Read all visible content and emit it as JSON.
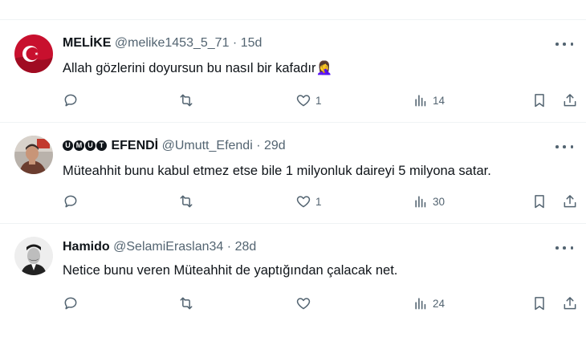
{
  "tweets": [
    {
      "name": "MELİKE",
      "handle": "@melike1453_5_71",
      "dot": "·",
      "time": "15d",
      "text": "Allah gözlerini doyursun bu nasıl bir kafadır",
      "emoji": "🤦‍♀️",
      "replies": "",
      "retweets": "",
      "likes": "1",
      "views": "14",
      "avatar": "turkish-flag"
    },
    {
      "name_badges": [
        "U",
        "M",
        "U",
        "T"
      ],
      "name": "EFENDİ",
      "handle": "@Umutt_Efendi",
      "dot": "·",
      "time": "29d",
      "text": "Müteahhit bunu kabul etmez etse bile 1 milyonluk daireyi 5 milyona satar.",
      "replies": "",
      "retweets": "",
      "likes": "1",
      "views": "30",
      "avatar": "man-photo"
    },
    {
      "name": "Hamido",
      "handle": "@SelamiEraslan34",
      "dot": "·",
      "time": "28d",
      "text": "Netice bunu veren Müteahhit de yaptığından çalacak net.",
      "replies": "",
      "retweets": "",
      "likes": "",
      "views": "24",
      "avatar": "vintage-portrait"
    }
  ],
  "colors": {
    "text": "#0f1419",
    "secondary": "#536471",
    "divider": "#eff3f4"
  }
}
